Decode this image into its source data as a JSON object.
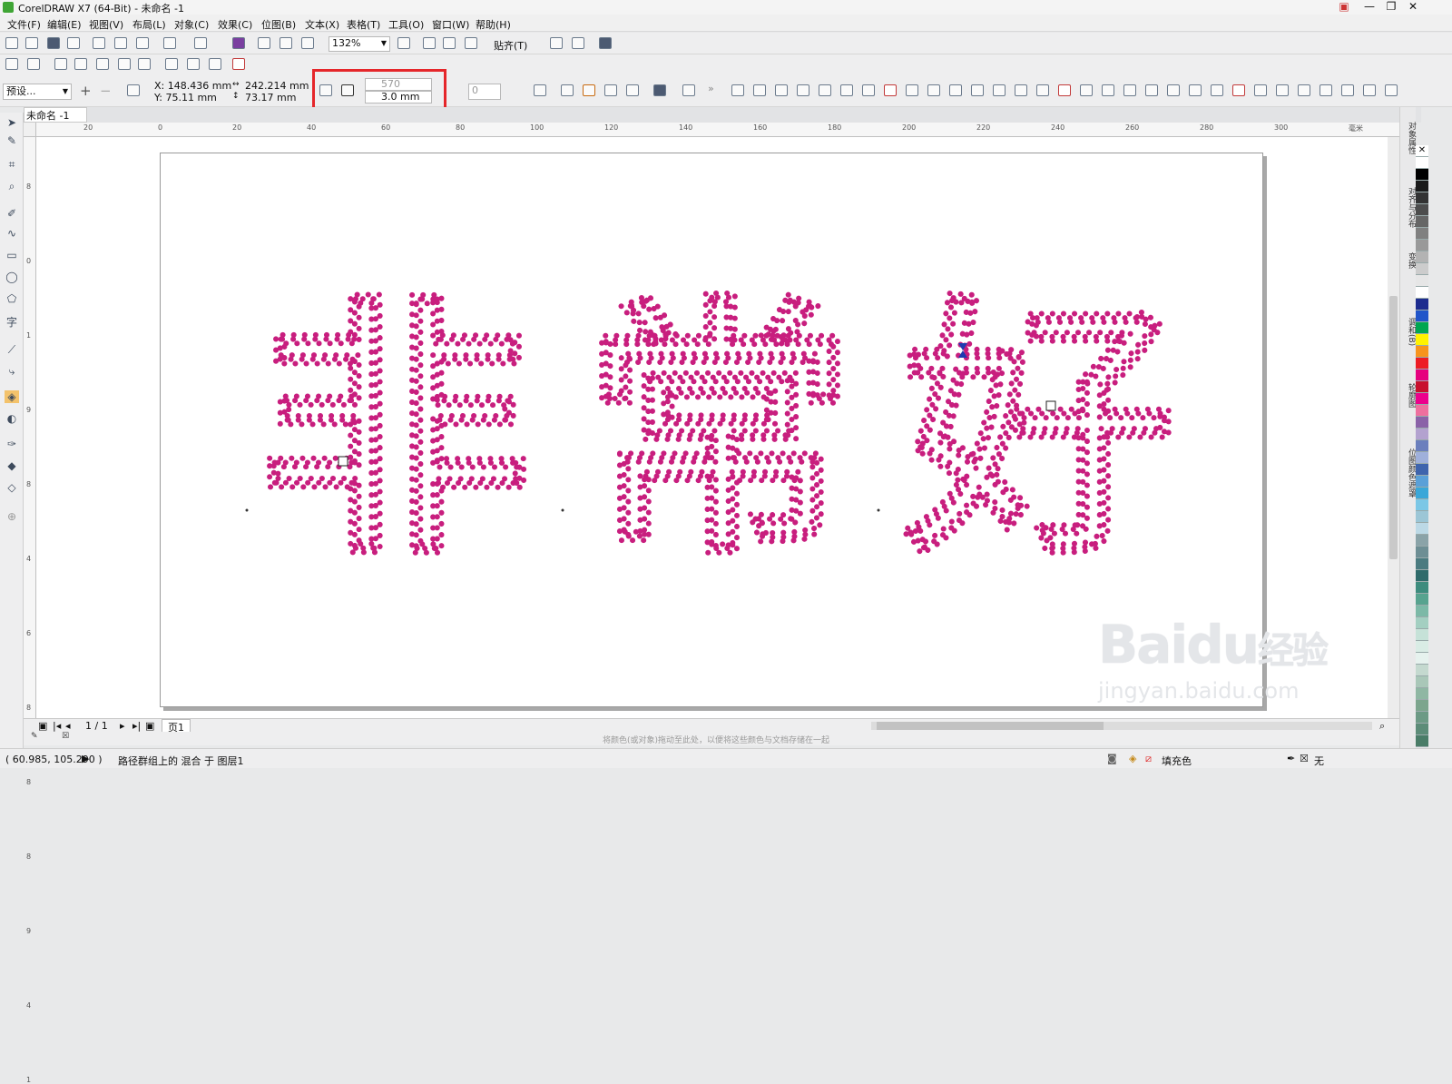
{
  "window": {
    "title": "CorelDRAW X7 (64-Bit) - 未命名 -1"
  },
  "menu": [
    "文件(F)",
    "编辑(E)",
    "视图(V)",
    "布局(L)",
    "对象(C)",
    "效果(C)",
    "位图(B)",
    "文本(X)",
    "表格(T)",
    "工具(O)",
    "窗口(W)",
    "帮助(H)"
  ],
  "toolbar": {
    "zoom": "132%",
    "snap": "贴齐(T)"
  },
  "propbar": {
    "preset": "预设...",
    "x": "X: 148.436 mm",
    "y": "Y: 75.11 mm",
    "width": "242.214 mm",
    "height": "73.17 mm",
    "blend_steps": "570",
    "blend_spacing": "3.0 mm",
    "rotation": "0"
  },
  "document": {
    "tab": "未命名 -1"
  },
  "ruler": {
    "h": [
      "20",
      "0",
      "20",
      "40",
      "60",
      "80",
      "100",
      "120",
      "140",
      "160",
      "180",
      "200",
      "220",
      "240",
      "260",
      "280",
      "300",
      "毫米"
    ],
    "v": [
      "8",
      "0",
      "1",
      "9",
      "8",
      "4",
      "6",
      "8",
      "8",
      "8",
      "9",
      "4",
      "1"
    ]
  },
  "canvas_text": [
    "非",
    "常",
    "好"
  ],
  "colors": {
    "dot": "#c81e7e",
    "redbox": "#e5262a"
  },
  "pagenav": {
    "count": "1 / 1",
    "page_tab": "页1"
  },
  "hint": "将颜色(或对象)拖动至此处，以便将这些颜色与文档存储在一起",
  "status": {
    "coords": "( 60.985, 105.290 )",
    "info": "路径群组上的 混合 于 图层1",
    "fill": "填充色",
    "outline": "无"
  },
  "docker_tabs": [
    "对象属性",
    "对齐与分布",
    "变换",
    "调和(B)",
    "轮廓图",
    "位图颜色遮罩"
  ],
  "palette": [
    "#ffffff",
    "#000000",
    "#1a1a1a",
    "#333333",
    "#4d4d4d",
    "#666666",
    "#808080",
    "#999999",
    "#b3b3b3",
    "#cccccc",
    "#e6e6e6",
    "#ffffff",
    "#1d2c8f",
    "#2155c9",
    "#00a651",
    "#fff200",
    "#f7941d",
    "#ed1c24",
    "#e6007e",
    "#c8102e",
    "#ec008c",
    "#ee6f9e",
    "#8b62a8",
    "#b3a2cf",
    "#6b7fbd",
    "#9fb0db",
    "#3e64ad",
    "#5aa0d8",
    "#3aa7d8",
    "#7bc7e6",
    "#9cc6d6",
    "#bcd9e6",
    "#8aa3a8",
    "#6d8e94",
    "#4a7b80",
    "#2f6b6b",
    "#3d8c7e",
    "#57a38f",
    "#7cb9a7",
    "#a3cfc1",
    "#c6e2d8",
    "#d9ece5",
    "#e6f2ee",
    "#c4d9cf",
    "#a9c7b8",
    "#8fb7a3",
    "#7ca58d",
    "#6c9a85",
    "#5c8c78",
    "#4a7d68"
  ],
  "watermark": {
    "brand": "Bai",
    "brand2": "du",
    "cn": "经验",
    "url": "jingyan.baidu.com"
  }
}
